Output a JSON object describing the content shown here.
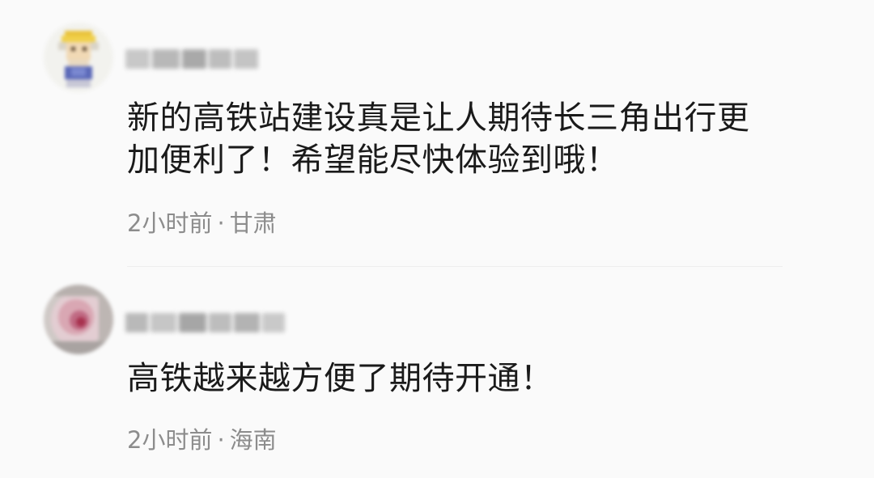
{
  "comments": [
    {
      "text": "新的高铁站建设真是让人期待长三角出行更加便利了！希望能尽快体验到哦！",
      "time": "2小时前",
      "separator": "·",
      "location": "甘肃"
    },
    {
      "text": "高铁越来越方便了期待开通！",
      "time": "2小时前",
      "separator": "·",
      "location": "海南"
    }
  ]
}
